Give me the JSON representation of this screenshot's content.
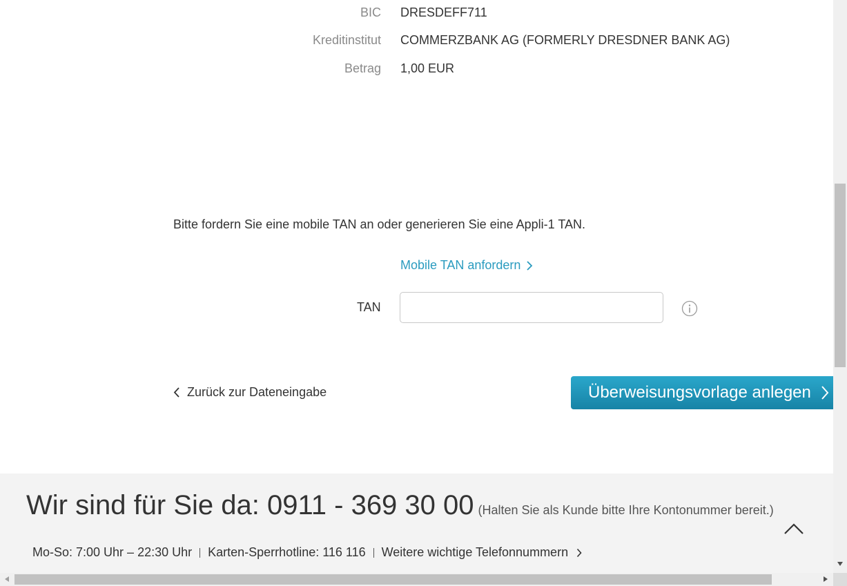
{
  "details": [
    {
      "label": "BIC",
      "value": "DRESDEFF711"
    },
    {
      "label": "Kreditinstitut",
      "value": "COMMERZBANK AG (FORMERLY DRESDNER BANK AG)"
    },
    {
      "label": "Betrag",
      "value": "1,00 EUR"
    }
  ],
  "tan_section": {
    "instruction": "Bitte fordern Sie eine mobile TAN an oder generieren Sie eine Appli-1 TAN.",
    "request_link": "Mobile TAN anfordern",
    "tan_label": "TAN",
    "tan_value": "",
    "tan_placeholder": ""
  },
  "actions": {
    "back_label": "Zurück zur Dateneingabe",
    "submit_label": "Überweisungsvorlage anlegen"
  },
  "footer": {
    "headline": "Wir sind für Sie da: 0911 - 369 30 00",
    "note": "(Halten Sie als Kunde bitte Ihre Kontonummer bereit.)",
    "hours": "Mo-So: 7:00 Uhr – 22:30 Uhr",
    "hotline": "Karten-Sperrhotline: 116 116",
    "more_numbers": "Weitere wichtige Telefonnummern"
  },
  "colors": {
    "accent": "#2a9bbf",
    "button_top": "#2aa7cb",
    "button_bottom": "#1783a6",
    "footer_bg": "#f3f3f3"
  },
  "icons": {
    "info": "info-circle-icon",
    "link_chevron": "chevron-right-icon",
    "back_chevron": "chevron-left-icon",
    "to_top": "chevron-up-icon"
  }
}
